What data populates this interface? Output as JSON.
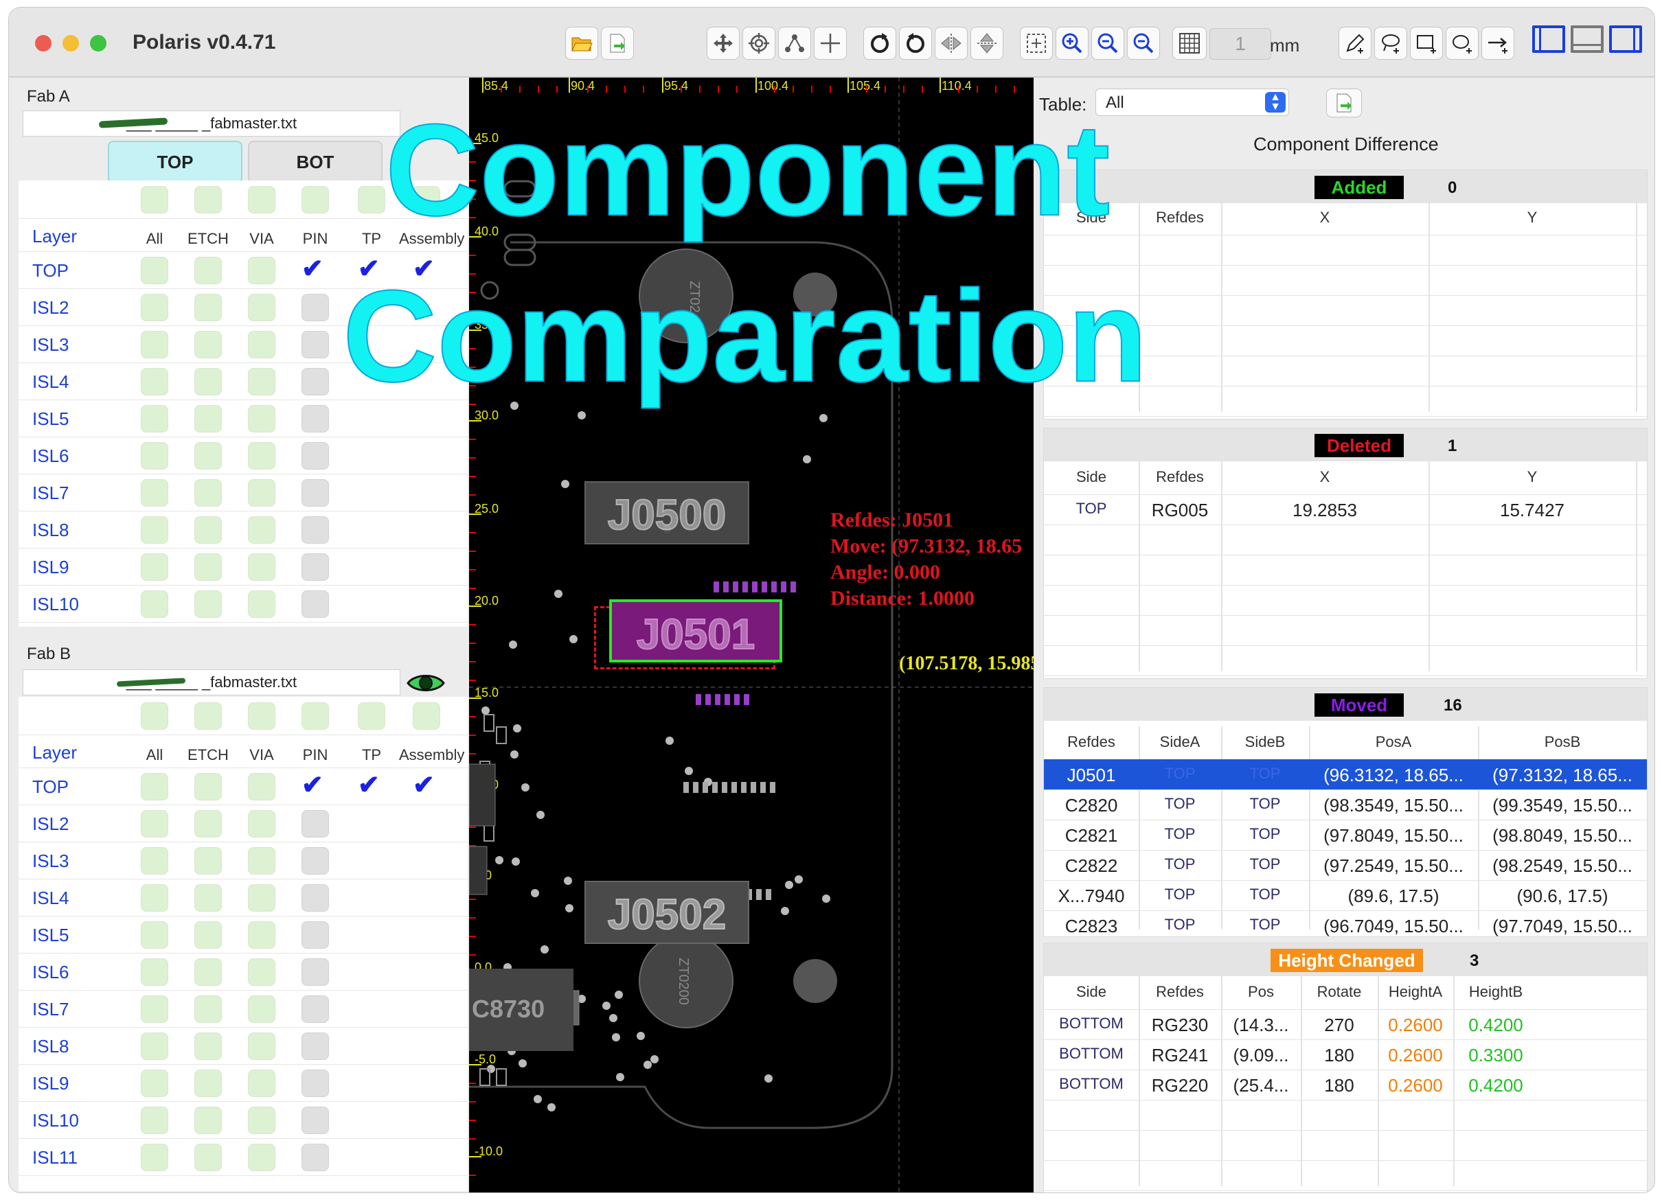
{
  "window": {
    "title": "Polaris v0.4.71"
  },
  "toolbar": {
    "grid_value": "1",
    "grid_unit": "mm"
  },
  "overlay": {
    "line1": "Component",
    "line2": "Comparation"
  },
  "fab_a": {
    "label": "Fab A",
    "file": "___ _____ _fabmaster.txt",
    "tab_top": "TOP",
    "tab_bot": "BOT"
  },
  "fab_b": {
    "label": "Fab B",
    "file": "___ _____ _fabmaster.txt"
  },
  "layers": {
    "headers": [
      "Layer",
      "All",
      "ETCH",
      "VIA",
      "PIN",
      "TP",
      "Assembly"
    ],
    "a": [
      "TOP",
      "ISL2",
      "ISL3",
      "ISL4",
      "ISL5",
      "ISL6",
      "ISL7",
      "ISL8",
      "ISL9",
      "ISL10"
    ],
    "b": [
      "TOP",
      "ISL2",
      "ISL3",
      "ISL4",
      "ISL5",
      "ISL6",
      "ISL7",
      "ISL8",
      "ISL9",
      "ISL10",
      "ISL11"
    ]
  },
  "canvas": {
    "top_ruler": [
      "85.4",
      "90.4",
      "95.4",
      "100.4",
      "105.4",
      "110.4"
    ],
    "left_ruler": [
      "45.0",
      "40.0",
      "35.0",
      "30.0",
      "25.0",
      "20.0",
      "15.0",
      "10.0",
      "5.0",
      "0.0",
      "-5.0",
      "-10.0"
    ],
    "comp_j0500": "J0500",
    "comp_j0501": "J0501",
    "comp_j0502": "J0502",
    "comp_c8730": "C8730",
    "zt_top": "ZT02",
    "zt_bottom": "ZT0200",
    "info_refdes": "Refdes: J0501",
    "info_move": "Move: (97.3132, 18.65",
    "info_angle": "Angle: 0.000",
    "info_distance": "Distance: 1.0000",
    "coord": "(107.5178, 15.985"
  },
  "right": {
    "table_label": "Table:",
    "table_select": "All",
    "title": "Component Difference",
    "added": {
      "label": "Added",
      "count": "0",
      "color": "#28d828",
      "headers": [
        "Side",
        "Refdes",
        "X",
        "Y"
      ]
    },
    "deleted": {
      "label": "Deleted",
      "count": "1",
      "color": "#e8141e",
      "headers": [
        "Side",
        "Refdes",
        "X",
        "Y"
      ],
      "rows": [
        {
          "side": "TOP",
          "refdes": "RG005",
          "x": "19.2853",
          "y": "15.7427"
        }
      ]
    },
    "moved": {
      "label": "Moved",
      "count": "16",
      "color": "#8a1ce8",
      "headers": [
        "Refdes",
        "SideA",
        "SideB",
        "PosA",
        "PosB"
      ],
      "rows": [
        {
          "refdes": "J0501",
          "sideA": "TOP",
          "sideB": "TOP",
          "posA": "(96.3132,  18.65...",
          "posB": "(97.3132,  18.65..."
        },
        {
          "refdes": "C2820",
          "sideA": "TOP",
          "sideB": "TOP",
          "posA": "(98.3549,  15.50...",
          "posB": "(99.3549,  15.50..."
        },
        {
          "refdes": "C2821",
          "sideA": "TOP",
          "sideB": "TOP",
          "posA": "(97.8049,  15.50...",
          "posB": "(98.8049,  15.50..."
        },
        {
          "refdes": "C2822",
          "sideA": "TOP",
          "sideB": "TOP",
          "posA": "(97.2549,  15.50...",
          "posB": "(98.2549,  15.50..."
        },
        {
          "refdes": "X...7940",
          "sideA": "TOP",
          "sideB": "TOP",
          "posA": "(89.6,  17.5)",
          "posB": "(90.6,  17.5)"
        },
        {
          "refdes": "C2823",
          "sideA": "TOP",
          "sideB": "TOP",
          "posA": "(96.7049,  15.50...",
          "posB": "(97.7049,  15.50..."
        }
      ]
    },
    "height": {
      "label": "Height Changed",
      "count": "3",
      "color": "#f79018",
      "headers": [
        "Side",
        "Refdes",
        "Pos",
        "Rotate",
        "HeightA",
        "HeightB"
      ],
      "rows": [
        {
          "side": "BOTTOM",
          "refdes": "RG230",
          "pos": "(14.3...",
          "rotate": "270",
          "heightA": "0.2600",
          "heightB": "0.4200"
        },
        {
          "side": "BOTTOM",
          "refdes": "RG241",
          "pos": "(9.09...",
          "rotate": "180",
          "heightA": "0.2600",
          "heightB": "0.3300"
        },
        {
          "side": "BOTTOM",
          "refdes": "RG220",
          "pos": "(25.4...",
          "rotate": "180",
          "heightA": "0.2600",
          "heightB": "0.4200"
        }
      ]
    }
  }
}
